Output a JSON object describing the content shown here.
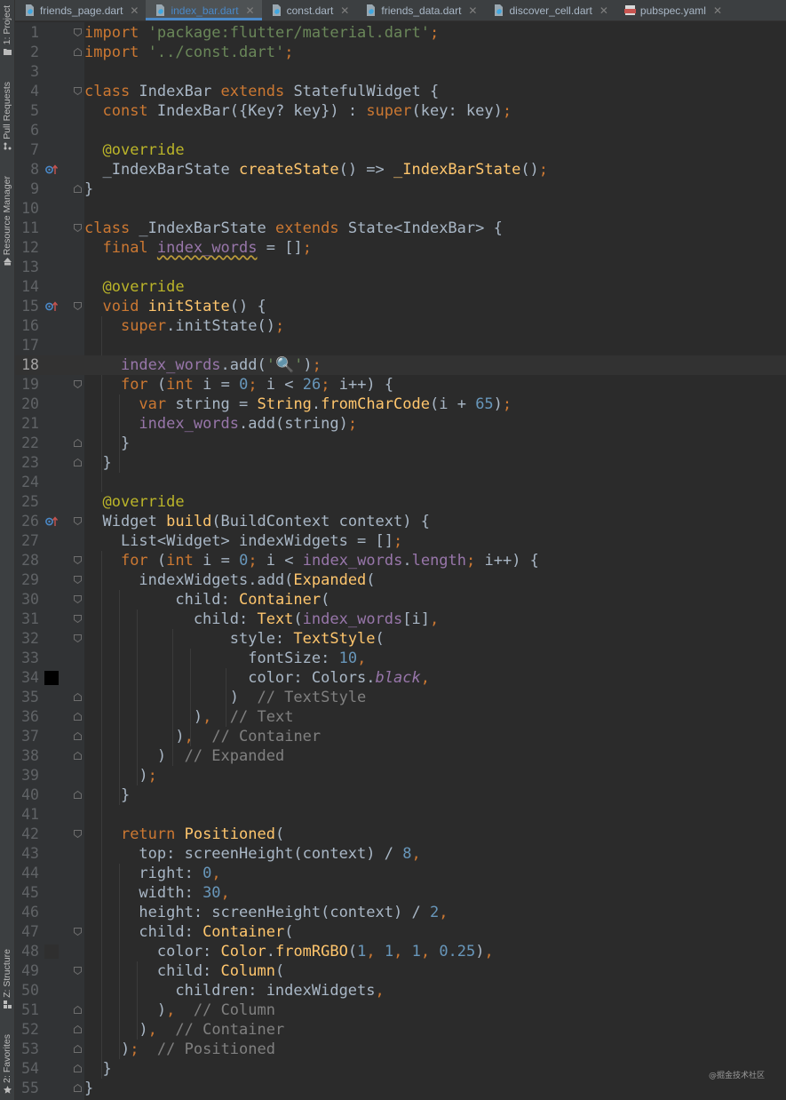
{
  "colors": {
    "keyword": "#cc7832",
    "string": "#6a8759",
    "number": "#6897bb",
    "function": "#ffc66d",
    "annotation": "#bbb529",
    "field": "#9876aa",
    "comment": "#808080",
    "text": "#a9b7c6",
    "tab_underline": "#4a88c7"
  },
  "toolwindows": {
    "project": "1: Project",
    "pull_requests": "Pull Requests",
    "resource_manager": "Resource Manager",
    "structure": "Z: Structure",
    "favorites": "2: Favorites"
  },
  "tabs": [
    {
      "label": "friends_page.dart",
      "icon": "dart-file-icon",
      "active": false
    },
    {
      "label": "index_bar.dart",
      "icon": "dart-file-icon",
      "active": true
    },
    {
      "label": "const.dart",
      "icon": "dart-file-icon",
      "active": false
    },
    {
      "label": "friends_data.dart",
      "icon": "dart-file-icon",
      "active": false
    },
    {
      "label": "discover_cell.dart",
      "icon": "dart-file-icon",
      "active": false
    },
    {
      "label": "pubspec.yaml",
      "icon": "yaml-file-icon",
      "active": false
    }
  ],
  "editor": {
    "current_line": 18,
    "lines": [
      {
        "n": "1",
        "fold": "open",
        "tokens": [
          [
            "kw",
            "import "
          ],
          [
            "str",
            "'package:flutter/material.dart'"
          ],
          [
            "kw",
            ";"
          ]
        ]
      },
      {
        "n": "2",
        "fold": "close",
        "tokens": [
          [
            "kw",
            "import "
          ],
          [
            "str",
            "'../const.dart'"
          ],
          [
            "kw",
            ";"
          ]
        ]
      },
      {
        "n": "3",
        "tokens": []
      },
      {
        "n": "4",
        "fold": "open",
        "tokens": [
          [
            "kw",
            "class "
          ],
          [
            "tp",
            "IndexBar "
          ],
          [
            "kw",
            "extends "
          ],
          [
            "tp",
            "StatefulWidget {"
          ]
        ]
      },
      {
        "n": "5",
        "tokens": [
          [
            "tp",
            "  "
          ],
          [
            "kw",
            "const "
          ],
          [
            "tp",
            "IndexBar({Key? key}) : "
          ],
          [
            "kw",
            "super"
          ],
          [
            "tp",
            "(key: key)"
          ],
          [
            "kw",
            ";"
          ]
        ]
      },
      {
        "n": "6",
        "tokens": []
      },
      {
        "n": "7",
        "tokens": [
          [
            "tp",
            "  "
          ],
          [
            "ann",
            "@override"
          ]
        ]
      },
      {
        "n": "8",
        "mark": "override",
        "tokens": [
          [
            "tp",
            "  _IndexBarState "
          ],
          [
            "fn",
            "createState"
          ],
          [
            "tp",
            "() => "
          ],
          [
            "fn",
            "_IndexBarState"
          ],
          [
            "tp",
            "()"
          ],
          [
            "kw",
            ";"
          ]
        ]
      },
      {
        "n": "9",
        "fold": "close",
        "tokens": [
          [
            "tp",
            "}"
          ]
        ]
      },
      {
        "n": "10",
        "tokens": []
      },
      {
        "n": "11",
        "fold": "open",
        "tokens": [
          [
            "kw",
            "class "
          ],
          [
            "tp",
            "_IndexBarState "
          ],
          [
            "kw",
            "extends "
          ],
          [
            "tp",
            "State<IndexBar> {"
          ]
        ]
      },
      {
        "n": "12",
        "tokens": [
          [
            "tp",
            "  "
          ],
          [
            "kw",
            "final "
          ],
          [
            "fldw",
            "index_words"
          ],
          [
            "tp",
            " = []"
          ],
          [
            "kw",
            ";"
          ]
        ]
      },
      {
        "n": "13",
        "tokens": []
      },
      {
        "n": "14",
        "tokens": [
          [
            "tp",
            "  "
          ],
          [
            "ann",
            "@override"
          ]
        ]
      },
      {
        "n": "15",
        "mark": "override",
        "fold": "open",
        "tokens": [
          [
            "tp",
            "  "
          ],
          [
            "kw",
            "void "
          ],
          [
            "fn",
            "initState"
          ],
          [
            "tp",
            "() {"
          ]
        ]
      },
      {
        "n": "16",
        "tokens": [
          [
            "tp",
            "    "
          ],
          [
            "kw",
            "super"
          ],
          [
            "tp",
            ".initState()"
          ],
          [
            "kw",
            ";"
          ]
        ]
      },
      {
        "n": "17",
        "tokens": []
      },
      {
        "n": "18",
        "tokens": [
          [
            "tp",
            "    "
          ],
          [
            "fld",
            "index_words"
          ],
          [
            "tp",
            ".add("
          ],
          [
            "str",
            "'🔍'"
          ],
          [
            "tp",
            ")"
          ],
          [
            "kw",
            ";"
          ]
        ]
      },
      {
        "n": "19",
        "fold": "open",
        "tokens": [
          [
            "tp",
            "    "
          ],
          [
            "kw",
            "for "
          ],
          [
            "tp",
            "("
          ],
          [
            "kw",
            "int "
          ],
          [
            "tp",
            "i = "
          ],
          [
            "num",
            "0"
          ],
          [
            "kw",
            "; "
          ],
          [
            "tp",
            "i < "
          ],
          [
            "num",
            "26"
          ],
          [
            "kw",
            "; "
          ],
          [
            "tp",
            "i++) {"
          ]
        ]
      },
      {
        "n": "20",
        "tokens": [
          [
            "tp",
            "      "
          ],
          [
            "kw",
            "var "
          ],
          [
            "tp",
            "string = "
          ],
          [
            "fn",
            "String"
          ],
          [
            "tp",
            "."
          ],
          [
            "fn",
            "fromCharCode"
          ],
          [
            "tp",
            "(i + "
          ],
          [
            "num",
            "65"
          ],
          [
            "tp",
            ")"
          ],
          [
            "kw",
            ";"
          ]
        ]
      },
      {
        "n": "21",
        "tokens": [
          [
            "tp",
            "      "
          ],
          [
            "fld",
            "index_words"
          ],
          [
            "tp",
            ".add(string)"
          ],
          [
            "kw",
            ";"
          ]
        ]
      },
      {
        "n": "22",
        "fold": "close",
        "tokens": [
          [
            "tp",
            "    }"
          ]
        ]
      },
      {
        "n": "23",
        "fold": "close",
        "tokens": [
          [
            "tp",
            "  }"
          ]
        ]
      },
      {
        "n": "24",
        "tokens": []
      },
      {
        "n": "25",
        "tokens": [
          [
            "tp",
            "  "
          ],
          [
            "ann",
            "@override"
          ]
        ]
      },
      {
        "n": "26",
        "mark": "override",
        "fold": "open",
        "tokens": [
          [
            "tp",
            "  Widget "
          ],
          [
            "fn",
            "build"
          ],
          [
            "tp",
            "(BuildContext context) {"
          ]
        ]
      },
      {
        "n": "27",
        "tokens": [
          [
            "tp",
            "    List<Widget> indexWidgets = []"
          ],
          [
            "kw",
            ";"
          ]
        ]
      },
      {
        "n": "28",
        "fold": "open",
        "tokens": [
          [
            "tp",
            "    "
          ],
          [
            "kw",
            "for "
          ],
          [
            "tp",
            "("
          ],
          [
            "kw",
            "int "
          ],
          [
            "tp",
            "i = "
          ],
          [
            "num",
            "0"
          ],
          [
            "kw",
            "; "
          ],
          [
            "tp",
            "i < "
          ],
          [
            "fld",
            "index_words"
          ],
          [
            "tp",
            "."
          ],
          [
            "fld",
            "length"
          ],
          [
            "kw",
            "; "
          ],
          [
            "tp",
            "i++) {"
          ]
        ]
      },
      {
        "n": "29",
        "fold": "open",
        "tokens": [
          [
            "tp",
            "      indexWidgets.add("
          ],
          [
            "fn",
            "Expanded"
          ],
          [
            "tp",
            "("
          ]
        ]
      },
      {
        "n": "30",
        "fold": "open",
        "tokens": [
          [
            "tp",
            "          child: "
          ],
          [
            "fn",
            "Container"
          ],
          [
            "tp",
            "("
          ]
        ]
      },
      {
        "n": "31",
        "fold": "open",
        "tokens": [
          [
            "tp",
            "            child: "
          ],
          [
            "fn",
            "Text"
          ],
          [
            "tp",
            "("
          ],
          [
            "fld",
            "index_words"
          ],
          [
            "tp",
            "[i]"
          ],
          [
            "kw",
            ","
          ]
        ]
      },
      {
        "n": "32",
        "fold": "open",
        "tokens": [
          [
            "tp",
            "                style: "
          ],
          [
            "fn",
            "TextStyle"
          ],
          [
            "tp",
            "("
          ]
        ]
      },
      {
        "n": "33",
        "tokens": [
          [
            "tp",
            "                  fontSize: "
          ],
          [
            "num",
            "10"
          ],
          [
            "kw",
            ","
          ]
        ]
      },
      {
        "n": "34",
        "swatch": "#000000",
        "tokens": [
          [
            "tp",
            "                  color: Colors."
          ],
          [
            "ital",
            "black"
          ],
          [
            "kw",
            ","
          ]
        ]
      },
      {
        "n": "35",
        "fold": "close",
        "tokens": [
          [
            "tp",
            "                )  "
          ],
          [
            "cmt",
            "// TextStyle"
          ]
        ]
      },
      {
        "n": "36",
        "fold": "close",
        "tokens": [
          [
            "tp",
            "            )"
          ],
          [
            "kw",
            ","
          ],
          [
            "tp",
            "  "
          ],
          [
            "cmt",
            "// Text"
          ]
        ]
      },
      {
        "n": "37",
        "fold": "close",
        "tokens": [
          [
            "tp",
            "          )"
          ],
          [
            "kw",
            ","
          ],
          [
            "tp",
            "  "
          ],
          [
            "cmt",
            "// Container"
          ]
        ]
      },
      {
        "n": "38",
        "fold": "close",
        "tokens": [
          [
            "tp",
            "        )  "
          ],
          [
            "cmt",
            "// Expanded"
          ]
        ]
      },
      {
        "n": "39",
        "tokens": [
          [
            "tp",
            "      )"
          ],
          [
            "kw",
            ";"
          ]
        ]
      },
      {
        "n": "40",
        "fold": "close",
        "tokens": [
          [
            "tp",
            "    }"
          ]
        ]
      },
      {
        "n": "41",
        "tokens": []
      },
      {
        "n": "42",
        "fold": "open",
        "tokens": [
          [
            "tp",
            "    "
          ],
          [
            "kw",
            "return "
          ],
          [
            "fn",
            "Positioned"
          ],
          [
            "tp",
            "("
          ]
        ]
      },
      {
        "n": "43",
        "tokens": [
          [
            "tp",
            "      top: screenHeight(context) / "
          ],
          [
            "num",
            "8"
          ],
          [
            "kw",
            ","
          ]
        ]
      },
      {
        "n": "44",
        "tokens": [
          [
            "tp",
            "      right: "
          ],
          [
            "num",
            "0"
          ],
          [
            "kw",
            ","
          ]
        ]
      },
      {
        "n": "45",
        "tokens": [
          [
            "tp",
            "      width: "
          ],
          [
            "num",
            "30"
          ],
          [
            "kw",
            ","
          ]
        ]
      },
      {
        "n": "46",
        "tokens": [
          [
            "tp",
            "      height: screenHeight(context) / "
          ],
          [
            "num",
            "2"
          ],
          [
            "kw",
            ","
          ]
        ]
      },
      {
        "n": "47",
        "fold": "open",
        "tokens": [
          [
            "tp",
            "      child: "
          ],
          [
            "fn",
            "Container"
          ],
          [
            "tp",
            "("
          ]
        ]
      },
      {
        "n": "48",
        "swatch": "#2f2f2f",
        "tokens": [
          [
            "tp",
            "        color: "
          ],
          [
            "fn",
            "Color"
          ],
          [
            "tp",
            "."
          ],
          [
            "fn",
            "fromRGBO"
          ],
          [
            "tp",
            "("
          ],
          [
            "num",
            "1"
          ],
          [
            "kw",
            ", "
          ],
          [
            "num",
            "1"
          ],
          [
            "kw",
            ", "
          ],
          [
            "num",
            "1"
          ],
          [
            "kw",
            ", "
          ],
          [
            "num",
            "0.25"
          ],
          [
            "tp",
            ")"
          ],
          [
            "kw",
            ","
          ]
        ]
      },
      {
        "n": "49",
        "fold": "open",
        "tokens": [
          [
            "tp",
            "        child: "
          ],
          [
            "fn",
            "Column"
          ],
          [
            "tp",
            "("
          ]
        ]
      },
      {
        "n": "50",
        "tokens": [
          [
            "tp",
            "          children: indexWidgets"
          ],
          [
            "kw",
            ","
          ]
        ]
      },
      {
        "n": "51",
        "fold": "close",
        "tokens": [
          [
            "tp",
            "        )"
          ],
          [
            "kw",
            ","
          ],
          [
            "tp",
            "  "
          ],
          [
            "cmt",
            "// Column"
          ]
        ]
      },
      {
        "n": "52",
        "fold": "close",
        "tokens": [
          [
            "tp",
            "      )"
          ],
          [
            "kw",
            ","
          ],
          [
            "tp",
            "  "
          ],
          [
            "cmt",
            "// Container"
          ]
        ]
      },
      {
        "n": "53",
        "fold": "close",
        "tokens": [
          [
            "tp",
            "    )"
          ],
          [
            "kw",
            ";"
          ],
          [
            "tp",
            "  "
          ],
          [
            "cmt",
            "// Positioned"
          ]
        ]
      },
      {
        "n": "54",
        "fold": "close",
        "tokens": [
          [
            "tp",
            "  }"
          ]
        ]
      },
      {
        "n": "55",
        "fold": "close",
        "tokens": [
          [
            "tp",
            "}"
          ]
        ]
      }
    ]
  },
  "watermark": "@掘金技术社区"
}
